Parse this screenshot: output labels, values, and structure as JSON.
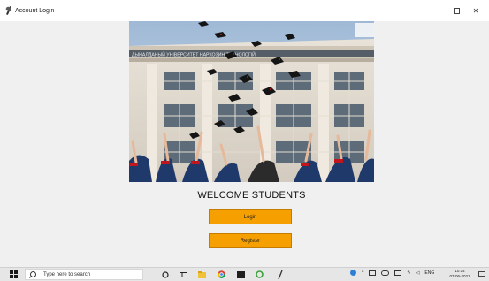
{
  "window": {
    "title": "Account Login",
    "controls": {
      "minimize": "minimize",
      "maximize": "maximize",
      "close": "✕"
    }
  },
  "main": {
    "hero_image": {
      "building_sign": "ДЫНАЛДАНЫЙ УНІВЕРСИТЕТ НАРХОЗИН ТЕХНОЛОГІЙ"
    },
    "welcome_text": "WELCOME STUDENTS",
    "login_button": "Login",
    "register_button": "Register",
    "accent_color": "#f5a000"
  },
  "taskbar": {
    "search_placeholder": "Type here to search",
    "language": "ENG",
    "time": "10:14",
    "date": "07-06-2021"
  }
}
